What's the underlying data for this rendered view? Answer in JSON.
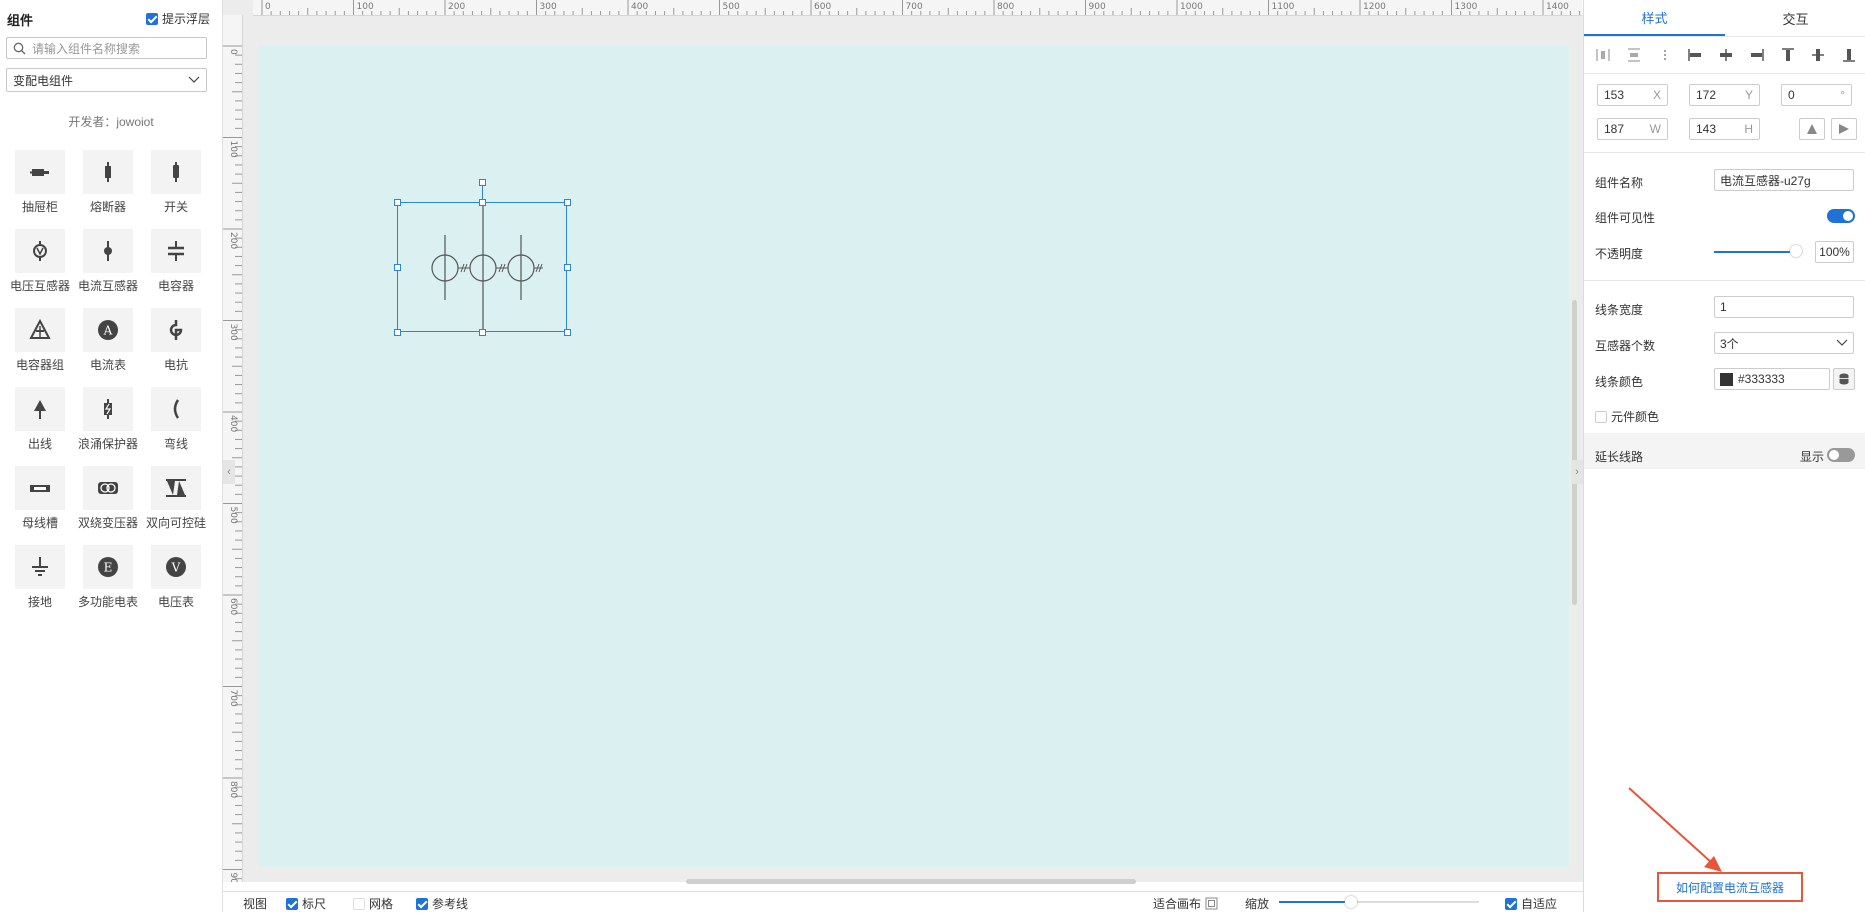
{
  "left_panel": {
    "title": "组件",
    "float_toggle_label": "提示浮层",
    "search_placeholder": "请输入组件名称搜索",
    "category": "变配电组件",
    "developer": "开发者：jowoiot",
    "components": [
      {
        "label": "抽屉柜",
        "icon": "drawer-cabinet-icon"
      },
      {
        "label": "熔断器",
        "icon": "fuse-icon"
      },
      {
        "label": "开关",
        "icon": "switch-icon"
      },
      {
        "label": "电压互感器",
        "icon": "voltage-transformer-icon"
      },
      {
        "label": "电流互感器",
        "icon": "current-transformer-icon"
      },
      {
        "label": "电容器",
        "icon": "capacitor-icon"
      },
      {
        "label": "电容器组",
        "icon": "capacitor-bank-icon"
      },
      {
        "label": "电流表",
        "icon": "ammeter-icon"
      },
      {
        "label": "电抗",
        "icon": "reactor-icon"
      },
      {
        "label": "出线",
        "icon": "outgoing-line-icon"
      },
      {
        "label": "浪涌保护器",
        "icon": "surge-protector-icon"
      },
      {
        "label": "弯线",
        "icon": "bent-line-icon"
      },
      {
        "label": "母线槽",
        "icon": "busbar-icon"
      },
      {
        "label": "双绕变压器",
        "icon": "dual-winding-transformer-icon"
      },
      {
        "label": "双向可控硅",
        "icon": "triac-icon"
      },
      {
        "label": "接地",
        "icon": "ground-icon"
      },
      {
        "label": "多功能电表",
        "icon": "multifunction-meter-icon"
      },
      {
        "label": "电压表",
        "icon": "voltmeter-icon"
      }
    ]
  },
  "ruler": {
    "top_labels": [
      "0",
      "100",
      "200",
      "300",
      "400",
      "500",
      "600",
      "700",
      "800",
      "900",
      "1000",
      "1100",
      "1200",
      "1300",
      "1400"
    ],
    "left_labels": [
      "0",
      "100",
      "200",
      "300",
      "400",
      "500",
      "600",
      "700",
      "800",
      "900"
    ]
  },
  "bottom_bar": {
    "view_label": "视图",
    "ruler_label": "标尺",
    "grid_label": "网格",
    "guides_label": "参考线",
    "fit_canvas_label": "适合画布",
    "zoom_label": "缩放",
    "adaptive_label": "自适应"
  },
  "right_panel": {
    "tabs": [
      "样式",
      "交互"
    ],
    "position": {
      "x": "153",
      "x_unit": "X",
      "y": "172",
      "y_unit": "Y",
      "rotation": "0",
      "rotation_unit": "°",
      "w": "187",
      "w_unit": "W",
      "h": "143",
      "h_unit": "H"
    },
    "props": {
      "name_label": "组件名称",
      "name_value": "电流互感器-u27g",
      "visible_label": "组件可见性",
      "opacity_label": "不透明度",
      "opacity_value": "100%",
      "line_width_label": "线条宽度",
      "line_width_value": "1",
      "transformer_count_label": "互感器个数",
      "transformer_count_value": "3个",
      "line_color_label": "线条颜色",
      "line_color_value": "#333333",
      "element_color_label": "元件颜色",
      "extend_line_label": "延长线路",
      "show_label": "显示"
    },
    "help_link": "如何配置电流互感器"
  },
  "colors": {
    "accent": "#1e72d8",
    "canvas": "#dbf0f1",
    "highlight": "#e8553a"
  }
}
